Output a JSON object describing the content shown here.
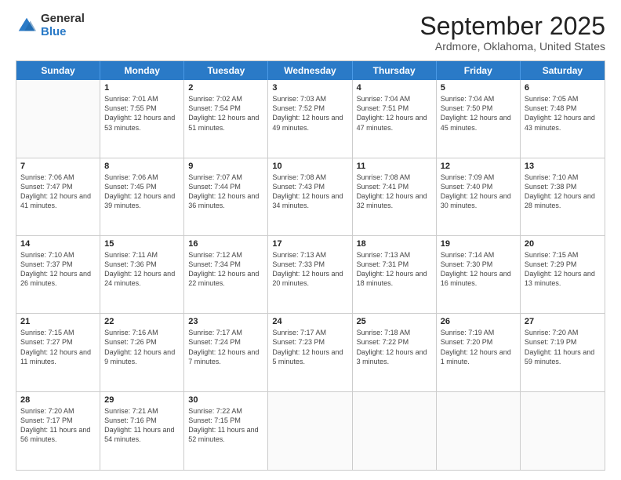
{
  "logo": {
    "general": "General",
    "blue": "Blue"
  },
  "title": "September 2025",
  "subtitle": "Ardmore, Oklahoma, United States",
  "days": [
    "Sunday",
    "Monday",
    "Tuesday",
    "Wednesday",
    "Thursday",
    "Friday",
    "Saturday"
  ],
  "weeks": [
    [
      {
        "date": "",
        "sunrise": "",
        "sunset": "",
        "daylight": ""
      },
      {
        "date": "1",
        "sunrise": "Sunrise: 7:01 AM",
        "sunset": "Sunset: 7:55 PM",
        "daylight": "Daylight: 12 hours and 53 minutes."
      },
      {
        "date": "2",
        "sunrise": "Sunrise: 7:02 AM",
        "sunset": "Sunset: 7:54 PM",
        "daylight": "Daylight: 12 hours and 51 minutes."
      },
      {
        "date": "3",
        "sunrise": "Sunrise: 7:03 AM",
        "sunset": "Sunset: 7:52 PM",
        "daylight": "Daylight: 12 hours and 49 minutes."
      },
      {
        "date": "4",
        "sunrise": "Sunrise: 7:04 AM",
        "sunset": "Sunset: 7:51 PM",
        "daylight": "Daylight: 12 hours and 47 minutes."
      },
      {
        "date": "5",
        "sunrise": "Sunrise: 7:04 AM",
        "sunset": "Sunset: 7:50 PM",
        "daylight": "Daylight: 12 hours and 45 minutes."
      },
      {
        "date": "6",
        "sunrise": "Sunrise: 7:05 AM",
        "sunset": "Sunset: 7:48 PM",
        "daylight": "Daylight: 12 hours and 43 minutes."
      }
    ],
    [
      {
        "date": "7",
        "sunrise": "Sunrise: 7:06 AM",
        "sunset": "Sunset: 7:47 PM",
        "daylight": "Daylight: 12 hours and 41 minutes."
      },
      {
        "date": "8",
        "sunrise": "Sunrise: 7:06 AM",
        "sunset": "Sunset: 7:45 PM",
        "daylight": "Daylight: 12 hours and 39 minutes."
      },
      {
        "date": "9",
        "sunrise": "Sunrise: 7:07 AM",
        "sunset": "Sunset: 7:44 PM",
        "daylight": "Daylight: 12 hours and 36 minutes."
      },
      {
        "date": "10",
        "sunrise": "Sunrise: 7:08 AM",
        "sunset": "Sunset: 7:43 PM",
        "daylight": "Daylight: 12 hours and 34 minutes."
      },
      {
        "date": "11",
        "sunrise": "Sunrise: 7:08 AM",
        "sunset": "Sunset: 7:41 PM",
        "daylight": "Daylight: 12 hours and 32 minutes."
      },
      {
        "date": "12",
        "sunrise": "Sunrise: 7:09 AM",
        "sunset": "Sunset: 7:40 PM",
        "daylight": "Daylight: 12 hours and 30 minutes."
      },
      {
        "date": "13",
        "sunrise": "Sunrise: 7:10 AM",
        "sunset": "Sunset: 7:38 PM",
        "daylight": "Daylight: 12 hours and 28 minutes."
      }
    ],
    [
      {
        "date": "14",
        "sunrise": "Sunrise: 7:10 AM",
        "sunset": "Sunset: 7:37 PM",
        "daylight": "Daylight: 12 hours and 26 minutes."
      },
      {
        "date": "15",
        "sunrise": "Sunrise: 7:11 AM",
        "sunset": "Sunset: 7:36 PM",
        "daylight": "Daylight: 12 hours and 24 minutes."
      },
      {
        "date": "16",
        "sunrise": "Sunrise: 7:12 AM",
        "sunset": "Sunset: 7:34 PM",
        "daylight": "Daylight: 12 hours and 22 minutes."
      },
      {
        "date": "17",
        "sunrise": "Sunrise: 7:13 AM",
        "sunset": "Sunset: 7:33 PM",
        "daylight": "Daylight: 12 hours and 20 minutes."
      },
      {
        "date": "18",
        "sunrise": "Sunrise: 7:13 AM",
        "sunset": "Sunset: 7:31 PM",
        "daylight": "Daylight: 12 hours and 18 minutes."
      },
      {
        "date": "19",
        "sunrise": "Sunrise: 7:14 AM",
        "sunset": "Sunset: 7:30 PM",
        "daylight": "Daylight: 12 hours and 16 minutes."
      },
      {
        "date": "20",
        "sunrise": "Sunrise: 7:15 AM",
        "sunset": "Sunset: 7:29 PM",
        "daylight": "Daylight: 12 hours and 13 minutes."
      }
    ],
    [
      {
        "date": "21",
        "sunrise": "Sunrise: 7:15 AM",
        "sunset": "Sunset: 7:27 PM",
        "daylight": "Daylight: 12 hours and 11 minutes."
      },
      {
        "date": "22",
        "sunrise": "Sunrise: 7:16 AM",
        "sunset": "Sunset: 7:26 PM",
        "daylight": "Daylight: 12 hours and 9 minutes."
      },
      {
        "date": "23",
        "sunrise": "Sunrise: 7:17 AM",
        "sunset": "Sunset: 7:24 PM",
        "daylight": "Daylight: 12 hours and 7 minutes."
      },
      {
        "date": "24",
        "sunrise": "Sunrise: 7:17 AM",
        "sunset": "Sunset: 7:23 PM",
        "daylight": "Daylight: 12 hours and 5 minutes."
      },
      {
        "date": "25",
        "sunrise": "Sunrise: 7:18 AM",
        "sunset": "Sunset: 7:22 PM",
        "daylight": "Daylight: 12 hours and 3 minutes."
      },
      {
        "date": "26",
        "sunrise": "Sunrise: 7:19 AM",
        "sunset": "Sunset: 7:20 PM",
        "daylight": "Daylight: 12 hours and 1 minute."
      },
      {
        "date": "27",
        "sunrise": "Sunrise: 7:20 AM",
        "sunset": "Sunset: 7:19 PM",
        "daylight": "Daylight: 11 hours and 59 minutes."
      }
    ],
    [
      {
        "date": "28",
        "sunrise": "Sunrise: 7:20 AM",
        "sunset": "Sunset: 7:17 PM",
        "daylight": "Daylight: 11 hours and 56 minutes."
      },
      {
        "date": "29",
        "sunrise": "Sunrise: 7:21 AM",
        "sunset": "Sunset: 7:16 PM",
        "daylight": "Daylight: 11 hours and 54 minutes."
      },
      {
        "date": "30",
        "sunrise": "Sunrise: 7:22 AM",
        "sunset": "Sunset: 7:15 PM",
        "daylight": "Daylight: 11 hours and 52 minutes."
      },
      {
        "date": "",
        "sunrise": "",
        "sunset": "",
        "daylight": ""
      },
      {
        "date": "",
        "sunrise": "",
        "sunset": "",
        "daylight": ""
      },
      {
        "date": "",
        "sunrise": "",
        "sunset": "",
        "daylight": ""
      },
      {
        "date": "",
        "sunrise": "",
        "sunset": "",
        "daylight": ""
      }
    ]
  ]
}
